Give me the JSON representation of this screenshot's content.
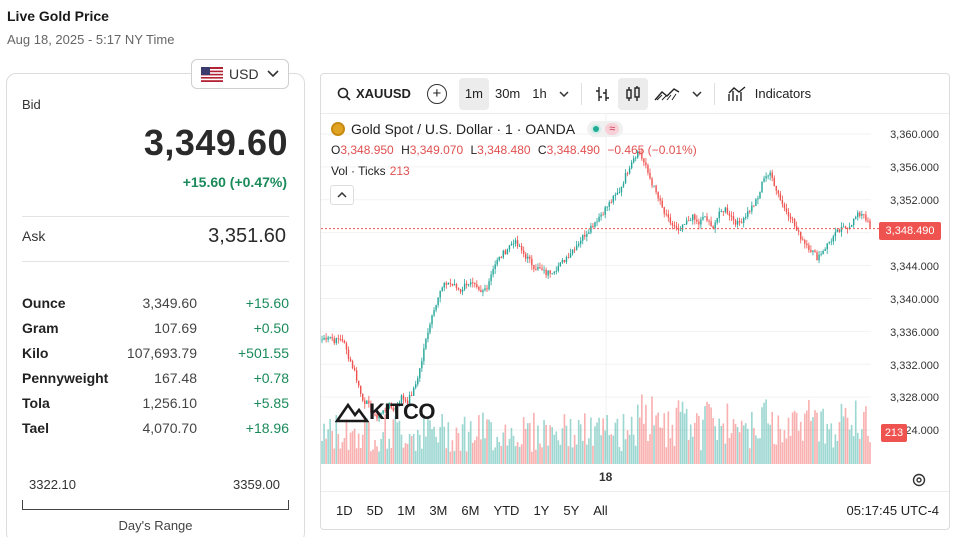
{
  "header": {
    "title": "Live Gold Price",
    "timestamp": "Aug 18, 2025 - 5:17 NY Time"
  },
  "currency": {
    "selected": "USD"
  },
  "quote": {
    "bid_label": "Bid",
    "bid": "3,349.60",
    "change": "+15.60 (+0.47%)",
    "ask_label": "Ask",
    "ask": "3,351.60"
  },
  "units": [
    {
      "name": "Ounce",
      "price": "3,349.60",
      "change": "+15.60"
    },
    {
      "name": "Gram",
      "price": "107.69",
      "change": "+0.50"
    },
    {
      "name": "Kilo",
      "price": "107,693.79",
      "change": "+501.55"
    },
    {
      "name": "Pennyweight",
      "price": "167.48",
      "change": "+0.78"
    },
    {
      "name": "Tola",
      "price": "1,256.10",
      "change": "+5.85"
    },
    {
      "name": "Tael",
      "price": "4,070.70",
      "change": "+18.96"
    }
  ],
  "days_range": {
    "low": "3322.10",
    "high": "3359.00",
    "label": "Day's Range"
  },
  "toolbar": {
    "symbol": "XAUUSD",
    "intervals": [
      "1m",
      "30m",
      "1h"
    ],
    "active_interval": "1m",
    "indicators_label": "Indicators"
  },
  "legend": {
    "title": "Gold Spot / U.S. Dollar · 1 · OANDA",
    "open_label": "O",
    "open": "3,348.950",
    "high_label": "H",
    "high": "3,349.070",
    "low_label": "L",
    "low": "3,348.480",
    "close_label": "C",
    "close": "3,348.490",
    "change": "−0.465 (−0.01%)",
    "vol_label": "Vol · Ticks",
    "vol_value": "213"
  },
  "yaxis_labels": [
    "3,360.000",
    "3,356.000",
    "3,352.000",
    "3,348.000",
    "3,344.000",
    "3,340.000",
    "3,336.000",
    "3,332.000",
    "3,328.000",
    "3,324.000"
  ],
  "price_tag": "3,348.490",
  "vol_tag": "213",
  "x_label": "18",
  "logo_text": "KITCO",
  "ranges": [
    "1D",
    "5D",
    "1M",
    "3M",
    "6M",
    "YTD",
    "1Y",
    "5Y",
    "All"
  ],
  "clock": "05:17:45 UTC-4",
  "colors": {
    "up": "#26a69a",
    "down": "#ef5350",
    "positive_text": "#1a8a5a"
  },
  "chart_data": {
    "type": "candlestick",
    "ylim": [
      3324,
      3360
    ],
    "close_path": [
      3335,
      3335.5,
      3334.8,
      3335.2,
      3333,
      3331,
      3328,
      3327,
      3325.5,
      3326,
      3327,
      3326.5,
      3328,
      3327.5,
      3329,
      3332,
      3336,
      3339,
      3341,
      3342,
      3341.5,
      3341,
      3342,
      3341.5,
      3340.5,
      3341.5,
      3344,
      3345,
      3346,
      3347,
      3346,
      3345,
      3344,
      3343.5,
      3343,
      3343.5,
      3344,
      3345,
      3346,
      3347,
      3348,
      3349,
      3350,
      3351,
      3352,
      3353,
      3355,
      3357,
      3358,
      3356,
      3354,
      3352,
      3350,
      3349,
      3348,
      3349,
      3350,
      3349,
      3350,
      3348.5,
      3350,
      3351,
      3350,
      3349,
      3350,
      3351,
      3352,
      3355,
      3355,
      3353,
      3351,
      3350,
      3348,
      3347,
      3346,
      3345,
      3346,
      3347,
      3348,
      3348.5,
      3349,
      3350,
      3350.5,
      3348.5
    ]
  }
}
